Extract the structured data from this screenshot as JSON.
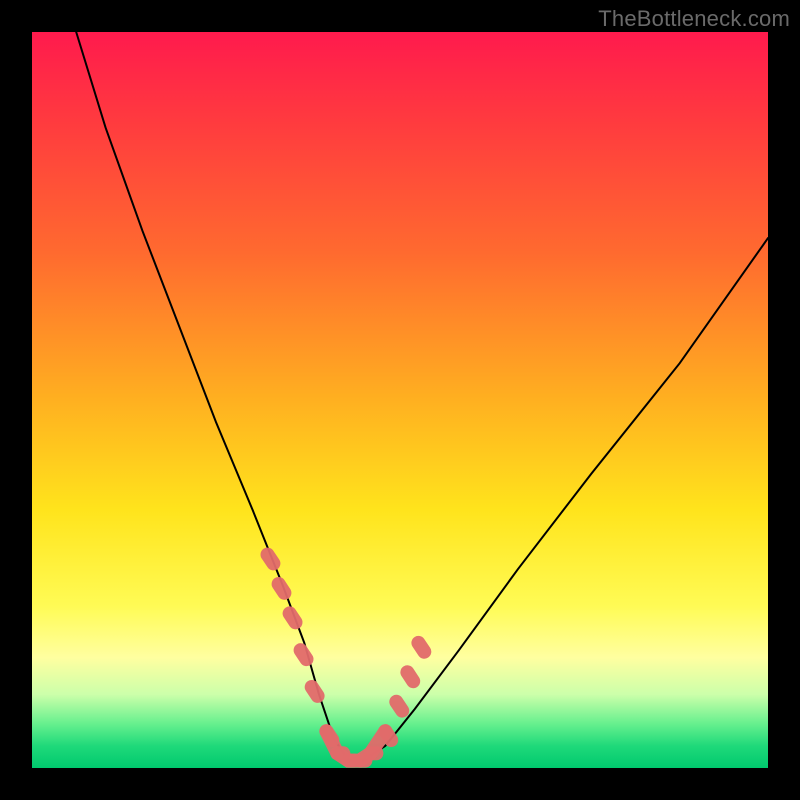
{
  "watermark": "TheBottleneck.com",
  "colors": {
    "frame": "#000000",
    "curve": "#000000",
    "overlay": "#e26a6a",
    "gradient_stops": [
      "#ff1a4d",
      "#ff3a3f",
      "#ff6a2f",
      "#ffb020",
      "#ffe41c",
      "#fffb55",
      "#ffffa0",
      "#ccffaa",
      "#66f08e",
      "#1fd97a",
      "#00c96e"
    ]
  },
  "chart_data": {
    "type": "line",
    "title": "",
    "xlabel": "",
    "ylabel": "",
    "xlim": [
      0,
      100
    ],
    "ylim": [
      0,
      100
    ],
    "note": "V-shaped bottleneck curve; y ≈ 0 is ideal (green), y ≈ 100 worst (red). Values estimated from pixel positions; minimum around x≈42.",
    "x": [
      6,
      10,
      15,
      20,
      25,
      30,
      34,
      37,
      39,
      41,
      43,
      45,
      48,
      52,
      58,
      66,
      76,
      88,
      100
    ],
    "values": [
      100,
      87,
      73,
      60,
      47,
      35,
      25,
      17,
      10,
      4,
      1,
      1,
      3,
      8,
      16,
      27,
      40,
      55,
      72
    ],
    "overlay_segments": {
      "note": "pink thick highlight segments near the trough, as pairs of (x, y)",
      "points": [
        [
          32,
          29
        ],
        [
          33.5,
          25
        ],
        [
          35,
          21
        ],
        [
          36.5,
          16
        ],
        [
          38,
          11
        ],
        [
          40,
          5
        ],
        [
          41.5,
          2
        ],
        [
          43,
          1
        ],
        [
          44.5,
          1
        ],
        [
          46,
          2
        ],
        [
          48,
          5
        ],
        [
          49.5,
          9
        ],
        [
          51,
          13
        ],
        [
          52.5,
          17
        ],
        [
          54,
          21
        ]
      ]
    }
  }
}
